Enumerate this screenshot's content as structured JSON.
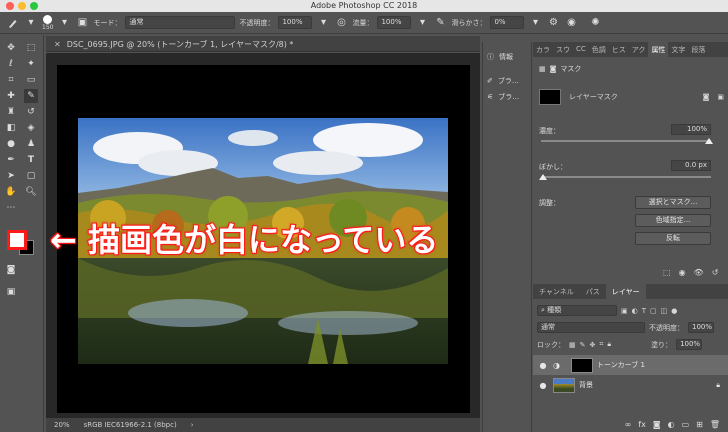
{
  "app": {
    "title": "Adobe Photoshop CC 2018",
    "traffic_light_colors": [
      "#fd5f57",
      "#fdbb2e",
      "#28c840"
    ]
  },
  "options_bar": {
    "brush_size": "150",
    "mode_label": "モード：",
    "mode_value": "通常",
    "opacity_label": "不透明度：",
    "opacity_value": "100%",
    "flow_label": "流量：",
    "flow_value": "100%",
    "smoothing_label": "滑らかさ：",
    "smoothing_value": "0%"
  },
  "document": {
    "tab_title": "DSC_0695.JPG @ 20% (トーンカーブ 1, レイヤーマスク/8) *",
    "zoom": "20%",
    "color_profile": "sRGB IEC61966-2.1 (8bpc)"
  },
  "mid_panel": {
    "items": [
      {
        "label": "情報",
        "icon": "info-icon"
      },
      {
        "label": "ブラ…",
        "icon": "brush-settings-icon"
      },
      {
        "label": "ブラ…",
        "icon": "brush-presets-icon"
      }
    ]
  },
  "properties_panel": {
    "tabs": [
      "カラ",
      "スウ",
      "CC",
      "色調",
      "ヒス",
      "アク",
      "属性",
      "文字",
      "段落"
    ],
    "active_tab": "属性",
    "header": "マスク",
    "mask_label": "レイヤーマスク",
    "density_label": "濃度：",
    "density_value": "100%",
    "feather_label": "ぼかし：",
    "feather_value": "0.0 px",
    "adjust_label": "調整：",
    "select_mask_button": "選択とマスク...",
    "color_range_button": "色域指定...",
    "invert_button": "反転"
  },
  "layers_panel": {
    "tabs": [
      "チャンネル",
      "パス",
      "レイヤー"
    ],
    "active_tab": "レイヤー",
    "filter_kind": "種類",
    "blend_mode": "通常",
    "opacity_label": "不透明度：",
    "opacity_value": "100%",
    "lock_label": "ロック：",
    "fill_label": "塗り：",
    "fill_value": "100%",
    "layers": [
      {
        "name": "トーンカーブ 1",
        "selected": true
      },
      {
        "name": "背景",
        "selected": false
      }
    ]
  },
  "annotation": {
    "text": "← 描画色が白になっている",
    "color": "#ff1a1a"
  }
}
